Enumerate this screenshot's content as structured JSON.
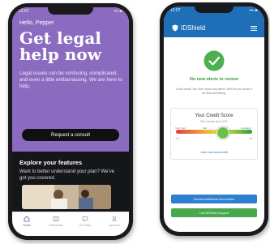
{
  "left_app": {
    "status": {
      "time": "12:07",
      "signal": "▪▪▪ ▰"
    },
    "greeting": "Hello, Pepper",
    "headline": "Get legal\nhelp now",
    "intro": "Legal issues can be confusing, complicated, and even a little embarrassing. We are here to help.",
    "consult_button": "Request a consult",
    "features_title": "Explore your features",
    "features_text": "Want to better understand your plan? We’ve got you covered.",
    "tabs": [
      {
        "label": "Home",
        "icon": "home-icon",
        "active": true
      },
      {
        "label": "Resources",
        "icon": "book-icon",
        "active": false
      },
      {
        "label": "Get Help",
        "icon": "chat-icon",
        "active": false
      },
      {
        "label": "Account",
        "icon": "person-icon",
        "active": false
      }
    ],
    "colors": {
      "hero": "#8b6bbf",
      "dark": "#15161a"
    }
  },
  "right_app": {
    "status": {
      "time": "12:07",
      "signal": "▪▪▪ ▰"
    },
    "brand": "IDShield",
    "alert_title": "No new alerts to review",
    "alert_text": "Good news! You don’t have any alerts. We’ll let you know if we find something.",
    "credit": {
      "title": "Your Credit Score",
      "subtitle": "See it score as of 1/27",
      "labels": [
        "Very Poor",
        "Fair",
        "Good",
        "Excellent"
      ],
      "scale": [
        "300",
        "",
        "",
        "",
        "850"
      ],
      "marker_fraction": 0.62,
      "link": "Learn more about credit"
    },
    "buttons": {
      "primary": "Review Additional Information",
      "secondary": "Call IDShield Support"
    },
    "colors": {
      "header": "#1f6fb8",
      "ok": "#49a84e"
    }
  }
}
